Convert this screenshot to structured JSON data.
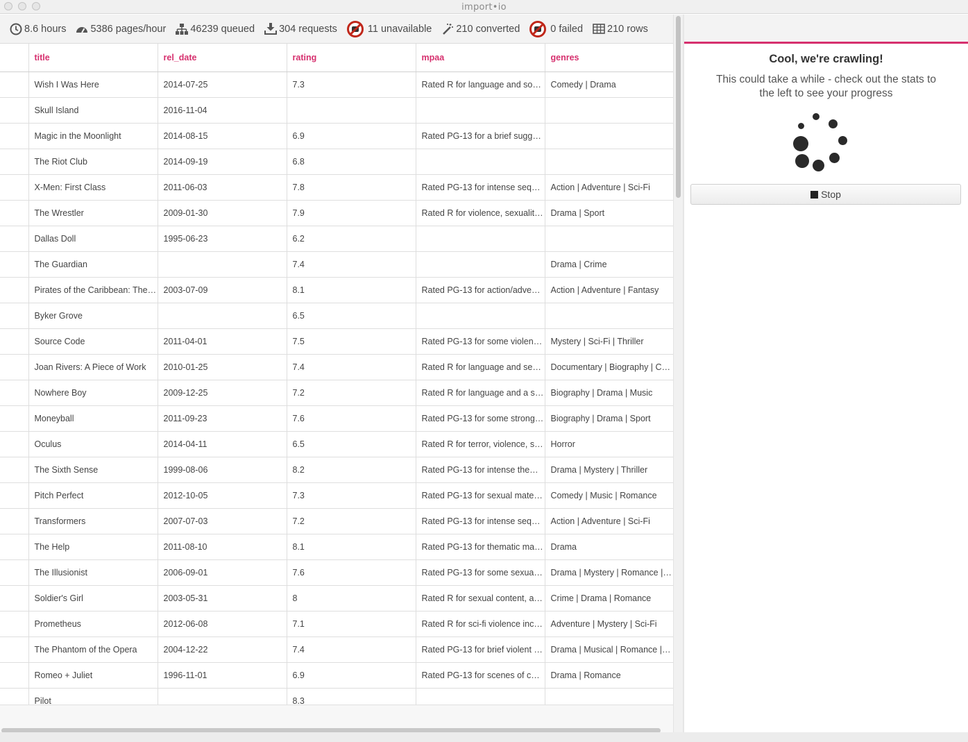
{
  "window": {
    "title": "import•io"
  },
  "stats": [
    {
      "icon": "clock-icon",
      "text": "8.6 hours"
    },
    {
      "icon": "speedometer-icon",
      "text": "5386 pages/hour"
    },
    {
      "icon": "sitemap-icon",
      "text": "46239 queued"
    },
    {
      "icon": "download-icon",
      "text": "304 requests"
    },
    {
      "icon": "unavailable-icon",
      "text": "11 unavailable"
    },
    {
      "icon": "magic-wand-icon",
      "text": "210 converted"
    },
    {
      "icon": "failed-icon",
      "text": "0 failed"
    },
    {
      "icon": "table-icon",
      "text": "210 rows"
    }
  ],
  "table": {
    "columns": [
      "title",
      "rel_date",
      "rating",
      "mpaa",
      "genres"
    ],
    "rows": [
      [
        "Wish I Was Here",
        "2014-07-25",
        "7.3",
        "Rated R for language and som…",
        "Comedy | Drama"
      ],
      [
        "Skull Island",
        "2016-11-04",
        "",
        "",
        ""
      ],
      [
        "Magic in the Moonlight",
        "2014-08-15",
        "6.9",
        "Rated PG-13 for a brief sugge…",
        ""
      ],
      [
        "The Riot Club",
        "2014-09-19",
        "6.8",
        "",
        ""
      ],
      [
        "X-Men: First Class",
        "2011-06-03",
        "7.8",
        "Rated PG-13 for intense sequ…",
        "Action | Adventure | Sci-Fi"
      ],
      [
        "The Wrestler",
        "2009-01-30",
        "7.9",
        "Rated R for violence, sexuality…",
        "Drama | Sport"
      ],
      [
        "Dallas Doll",
        "1995-06-23",
        "6.2",
        "",
        ""
      ],
      [
        "The Guardian",
        "",
        "7.4",
        "",
        "Drama | Crime"
      ],
      [
        "Pirates of the Caribbean: The …",
        "2003-07-09",
        "8.1",
        "Rated PG-13 for action/adven…",
        "Action | Adventure | Fantasy"
      ],
      [
        "Byker Grove",
        "",
        "6.5",
        "",
        ""
      ],
      [
        "Source Code",
        "2011-04-01",
        "7.5",
        "Rated PG-13 for some violenc…",
        "Mystery | Sci-Fi | Thriller"
      ],
      [
        "Joan Rivers: A Piece of Work",
        "2010-01-25",
        "7.4",
        "Rated R for language and sexu…",
        "Documentary | Biography | Co…"
      ],
      [
        "Nowhere Boy",
        "2009-12-25",
        "7.2",
        "Rated R for language and a sc…",
        "Biography | Drama | Music"
      ],
      [
        "Moneyball",
        "2011-09-23",
        "7.6",
        "Rated PG-13 for some strong l…",
        "Biography | Drama | Sport"
      ],
      [
        "Oculus",
        "2014-04-11",
        "6.5",
        "Rated R for terror, violence, so…",
        "Horror"
      ],
      [
        "The Sixth Sense",
        "1999-08-06",
        "8.2",
        "Rated PG-13 for intense them…",
        "Drama | Mystery | Thriller"
      ],
      [
        "Pitch Perfect",
        "2012-10-05",
        "7.3",
        "Rated PG-13 for sexual materi…",
        "Comedy | Music | Romance"
      ],
      [
        "Transformers",
        "2007-07-03",
        "7.2",
        "Rated PG-13 for intense sequ…",
        "Action | Adventure | Sci-Fi"
      ],
      [
        "The Help",
        "2011-08-10",
        "8.1",
        "Rated PG-13 for thematic mat…",
        "Drama"
      ],
      [
        "The Illusionist",
        "2006-09-01",
        "7.6",
        "Rated PG-13 for some sexuali…",
        "Drama | Mystery | Romance | …"
      ],
      [
        "Soldier's Girl",
        "2003-05-31",
        "8",
        "Rated R for sexual content, a s…",
        "Crime | Drama | Romance"
      ],
      [
        "Prometheus",
        "2012-06-08",
        "7.1",
        "Rated R for sci-fi violence incl…",
        "Adventure | Mystery | Sci-Fi"
      ],
      [
        "The Phantom of the Opera",
        "2004-12-22",
        "7.4",
        "Rated PG-13 for brief violent i…",
        "Drama | Musical | Romance | T…"
      ],
      [
        "Romeo + Juliet",
        "1996-11-01",
        "6.9",
        "Rated PG-13 for scenes of co…",
        "Drama | Romance"
      ],
      [
        "Pilot",
        "",
        "8.3",
        "",
        ""
      ]
    ]
  },
  "panel": {
    "title": "Cool, we're crawling!",
    "message": "This could take a while - check out the stats to the left to see your progress",
    "stop_label": "Stop"
  },
  "colors": {
    "accent": "#d6306e",
    "error": "#c0271a"
  }
}
